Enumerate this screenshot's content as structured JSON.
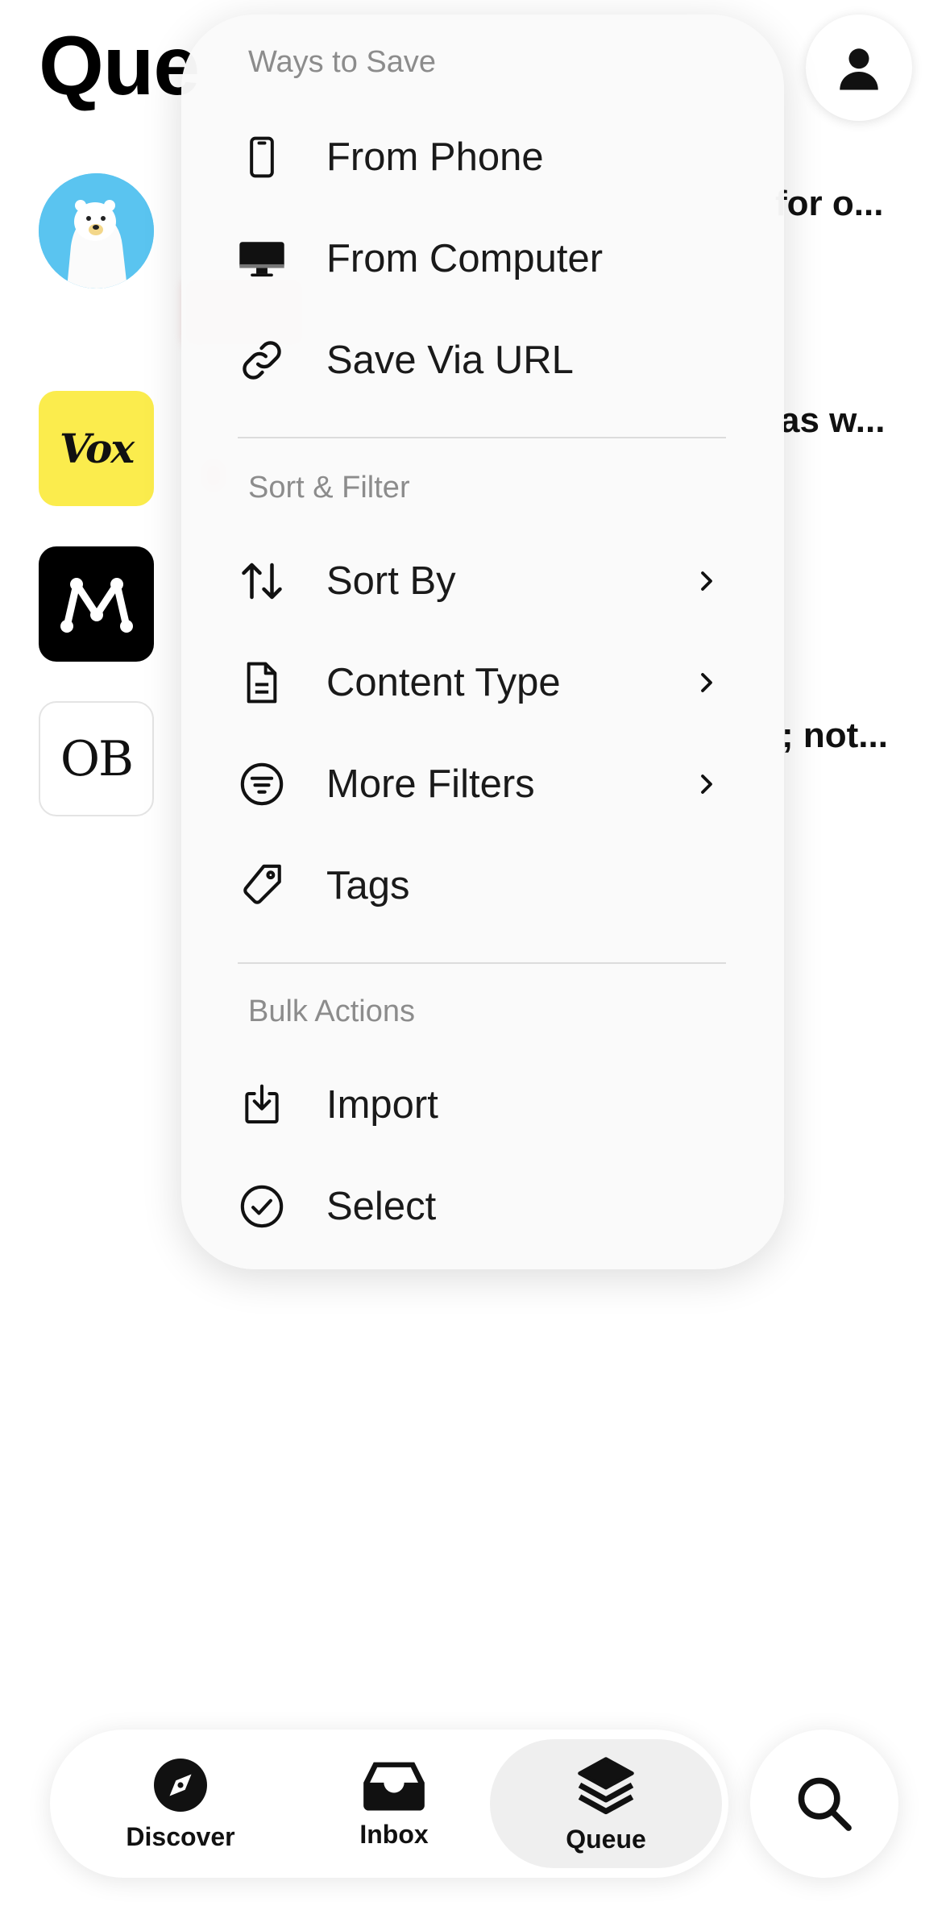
{
  "page": {
    "title": "Que"
  },
  "background_feed": {
    "items": [
      {
        "thumb": "polar-bear-avatar",
        "snippet": "for o..."
      },
      {
        "thumb": "vox-logo",
        "logo_text": "Vox",
        "snippet": "as w..."
      },
      {
        "thumb": "medium-logo"
      },
      {
        "thumb": "ob-logo",
        "logo_text": "OB",
        "snippet": "; not..."
      }
    ]
  },
  "menu": {
    "sections": {
      "ways_to_save": "Ways to Save",
      "sort_filter": "Sort & Filter",
      "bulk_actions": "Bulk Actions"
    },
    "items": {
      "from_phone": "From Phone",
      "from_computer": "From Computer",
      "save_via_url": "Save Via URL",
      "sort_by": "Sort By",
      "content_type": "Content Type",
      "more_filters": "More Filters",
      "tags": "Tags",
      "import": "Import",
      "select": "Select"
    }
  },
  "tabbar": {
    "tabs": [
      {
        "label": "Discover",
        "icon": "compass-icon",
        "active": false
      },
      {
        "label": "Inbox",
        "icon": "inbox-tray-icon",
        "active": false
      },
      {
        "label": "Queue",
        "icon": "stack-layers-icon",
        "active": true
      }
    ]
  },
  "colors": {
    "vox_yellow": "#fbec4d",
    "bear_blue": "#5ac4f0",
    "menu_bg": "#fafafa",
    "active_tab_bg": "#efefef"
  }
}
